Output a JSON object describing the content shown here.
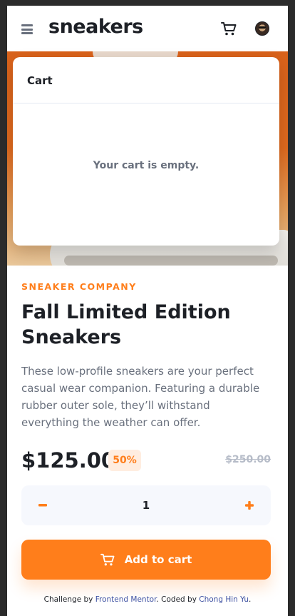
{
  "header": {
    "logo": "sneakers",
    "menu_icon": "hamburger-menu-icon",
    "cart_icon": "cart-icon",
    "avatar_icon": "user-avatar"
  },
  "cart": {
    "title": "Cart",
    "empty_message": "Your cart is empty."
  },
  "product": {
    "company": "SNEAKER COMPANY",
    "title": "Fall Limited Edition Sneakers",
    "description": "These low-profile sneakers are your perfect casual wear companion. Featuring a durable rubber outer sole, they’ll withstand everything the weather can offer.",
    "price": "$125.00",
    "discount": "50%",
    "original_price": "$250.00"
  },
  "quantity": {
    "minus_label": "−",
    "value": "1",
    "plus_label": "+"
  },
  "actions": {
    "add_to_cart_label": "Add to cart"
  },
  "footer": {
    "prefix": "Challenge by ",
    "challenge_link": "Frontend Mentor",
    "middle": ". Coded by ",
    "author_link": "Chong Hin Yu",
    "suffix": "."
  },
  "colors": {
    "accent": "#ff7e1b",
    "accent_light": "#ffede0",
    "dark": "#1d2026",
    "muted": "#69707d",
    "light_bg": "#f6f8fd"
  }
}
